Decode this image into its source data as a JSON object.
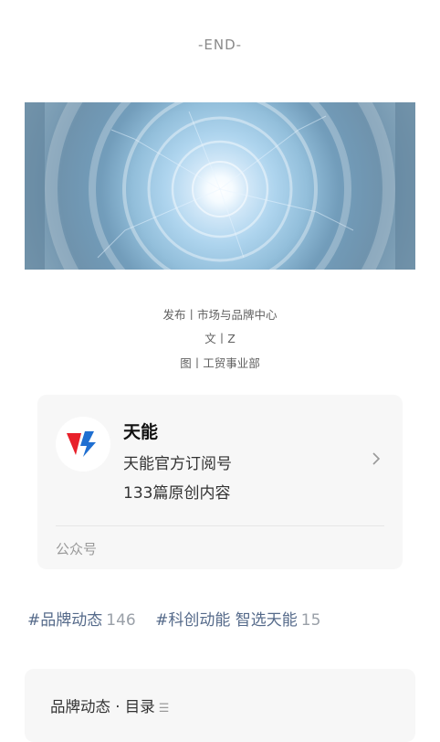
{
  "end_marker": "-END-",
  "credits": {
    "publish": "发布丨市场与品牌中心",
    "text": "文丨Z",
    "image": "图丨工贸事业部"
  },
  "account": {
    "name": "天能",
    "description": "天能官方订阅号",
    "original_count": "133篇原创内容",
    "type": "公众号",
    "logo_colors": {
      "red": "#e8202a",
      "blue": "#1f6fd1"
    }
  },
  "tags": [
    {
      "hash": "#",
      "name": "品牌动态",
      "count": "146"
    },
    {
      "hash": "#",
      "name": "科创动能 智选天能",
      "count": "15"
    }
  ],
  "toc": {
    "label": "品牌动态 · 目录",
    "icon": "list-menu-icon"
  }
}
